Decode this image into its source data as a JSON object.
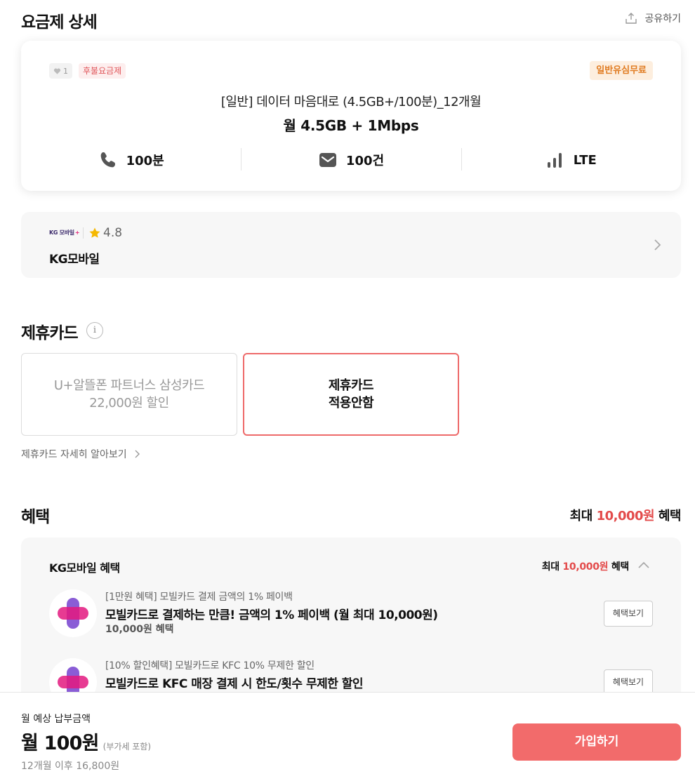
{
  "header": {
    "title": "요금제 상세",
    "share_label": "공유하기"
  },
  "plan": {
    "likes": "1",
    "tag_postpaid": "후불요금제",
    "tag_usim": "일반유심무료",
    "name": "[일반] 데이터 마음대로 (4.5GB+/100분)_12개월",
    "data": "월 4.5GB + 1Mbps",
    "specs": [
      {
        "icon": "phone-icon",
        "value": "100분"
      },
      {
        "icon": "message-icon",
        "value": "100건"
      },
      {
        "icon": "signal-icon",
        "value": "LTE"
      }
    ]
  },
  "carrier": {
    "logo_text": "KG 모바일",
    "logo_plus": "+",
    "rating": "4.8",
    "name": "KG모바일"
  },
  "partner_card": {
    "title": "제휴카드",
    "info_icon": "i",
    "options": [
      {
        "line1": "U+알뜰폰 파트너스 삼성카드",
        "line2": "22,000원 할인",
        "selected": false
      },
      {
        "line1": "제휴카드",
        "line2": "적용안함",
        "selected": true
      }
    ],
    "more_label": "제휴카드 자세히 알아보기"
  },
  "benefits": {
    "title": "혜택",
    "max_prefix": "최대",
    "max_amount": "10,000원",
    "max_suffix": "혜택",
    "group": {
      "title": "KG모바일 혜택",
      "max_prefix": "최대",
      "max_amount": "10,000원",
      "max_suffix": "혜택",
      "items": [
        {
          "sub": "[1만원 혜택] 모빌카드 결제 금액의 1% 페이백",
          "main": "모빌카드로 결제하는 만큼! 금액의 1% 페이백 (월 최대 10,000원)",
          "amount": "10,000원 혜택",
          "button": "혜택보기"
        },
        {
          "sub": "[10% 할인혜택] 모빌카드로 KFC 10% 무제한 할인",
          "main": "모빌카드로 KFC 매장 결제 시 한도/횟수 무제한 할인",
          "amount": "",
          "button": "혜택보기"
        }
      ]
    }
  },
  "bottom": {
    "label": "월 예상 납부금액",
    "price": "월 100원",
    "vat": "(부가세 포함)",
    "after": "12개월 이후 16,800원",
    "join": "가입하기"
  },
  "colors": {
    "accent": "#f26b6b",
    "highlight": "#e34b4b",
    "tag_usim_bg": "#fdeede",
    "tag_usim_text": "#e07a1f"
  }
}
